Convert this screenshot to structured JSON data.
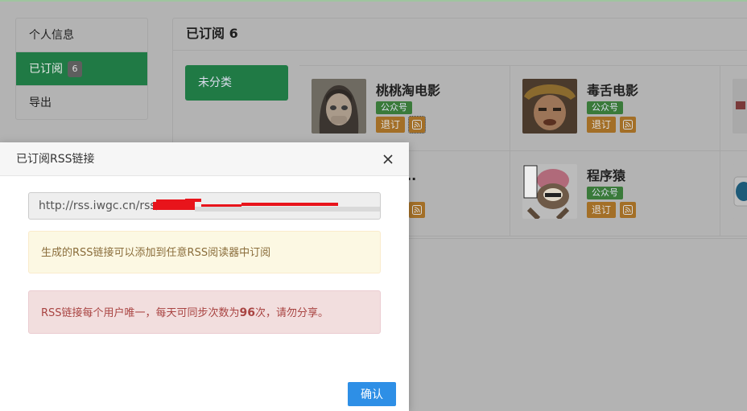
{
  "sidebar": {
    "items": [
      {
        "label": "个人信息"
      },
      {
        "label": "已订阅",
        "badge": "6"
      },
      {
        "label": "导出"
      }
    ]
  },
  "panel": {
    "title": "已订阅 6",
    "category_button": "未分类"
  },
  "cards": [
    {
      "name": "桃桃淘电影",
      "type_badge": "公众号",
      "unsubscribe_label": "退订",
      "rss_icon": "rss-icon"
    },
    {
      "name": "毒舌电影",
      "type_badge": "公众号",
      "unsubscribe_label": "退订",
      "rss_icon": "rss-icon"
    },
    {
      "name": "程序...",
      "type_badge": "",
      "unsubscribe_label": "",
      "rss_icon": "rss-icon"
    },
    {
      "name": "程序猿",
      "type_badge": "公众号",
      "unsubscribe_label": "退订",
      "rss_icon": "rss-icon"
    }
  ],
  "modal": {
    "title": "已订阅RSS链接",
    "close_icon": "close-icon",
    "url_value": "http://rss.iwgc.cn/rss/",
    "info_text": "生成的RSS链接可以添加到任意RSS阅读器中订阅",
    "warn_prefix": "RSS链接每个用户唯一，每天可同步次数为",
    "warn_count": "96",
    "warn_suffix": "次，请勿分享。",
    "confirm_label": "确认"
  },
  "colors": {
    "primary_green": "#207a45",
    "badge_green": "#3a7a3a",
    "unsub_orange": "#a36f27",
    "confirm_blue": "#2e8fe6"
  }
}
